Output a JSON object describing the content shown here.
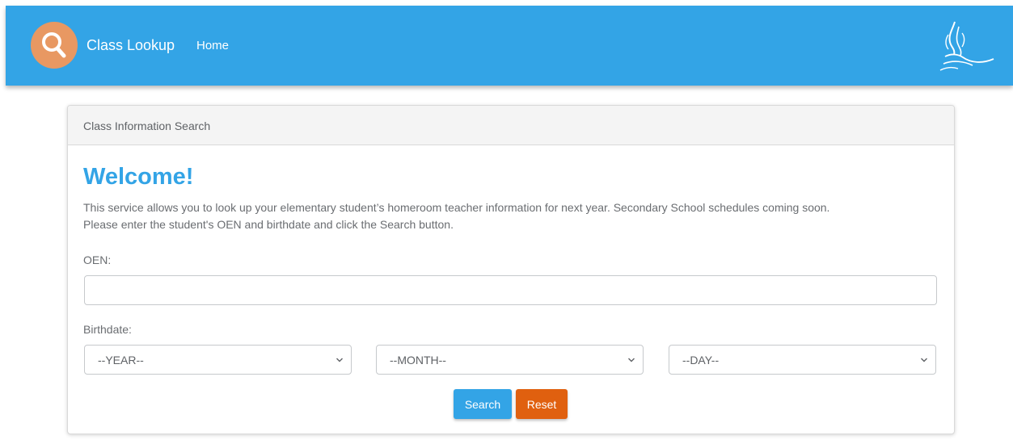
{
  "navbar": {
    "brand": "Class Lookup",
    "home_link": "Home",
    "icons": {
      "logo": "search-magnifier-icon",
      "board_logo": "school-board-logo"
    }
  },
  "card": {
    "header": "Class Information Search",
    "heading": "Welcome!",
    "intro_line1": "This service allows you to look up your elementary student’s homeroom teacher information for next year. Secondary School schedules coming soon.",
    "intro_line2": "Please enter the student's OEN and birthdate and click the Search button."
  },
  "form": {
    "oen_label": "OEN:",
    "oen_value": "",
    "birthdate_label": "Birthdate:",
    "year_select": "--YEAR--",
    "month_select": "--MONTH--",
    "day_select": "--DAY--",
    "search_button": "Search",
    "reset_button": "Reset"
  },
  "colors": {
    "primary": "#33a4e6",
    "logo_circle": "#e89862",
    "reset": "#e0600f"
  }
}
